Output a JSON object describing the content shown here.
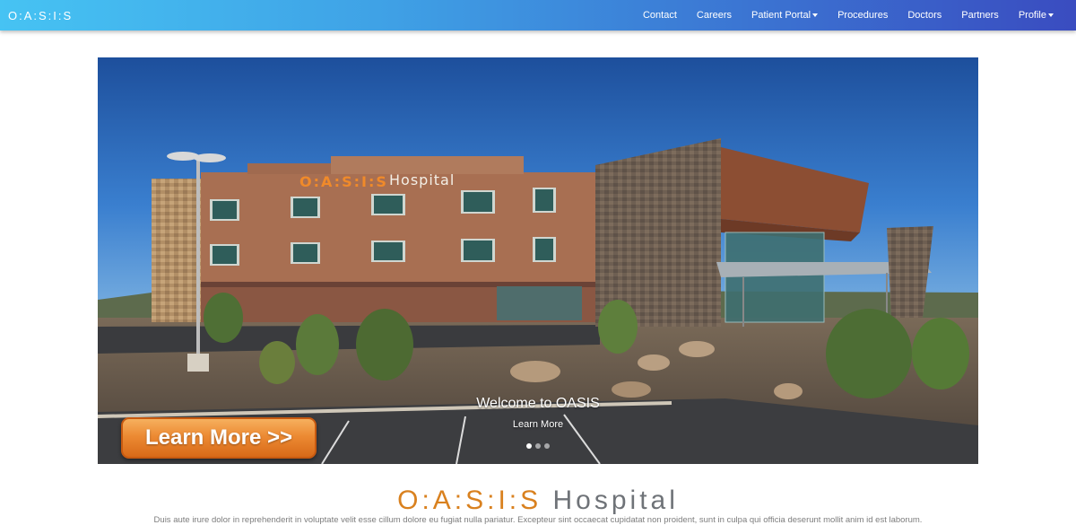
{
  "navbar": {
    "brand": "O:A:S:I:S",
    "links": [
      {
        "label": "Contact"
      },
      {
        "label": "Careers"
      },
      {
        "label": "Patient Portal"
      },
      {
        "label": "Procedures"
      },
      {
        "label": "Doctors"
      },
      {
        "label": "Partners"
      },
      {
        "label": "Profile"
      }
    ]
  },
  "carousel": {
    "building_sign": {
      "accent": "O:A:S:I:S",
      "rest": " Hospital"
    },
    "caption_title": "Welcome to OASIS",
    "caption_link": "Learn More",
    "slide_count": 3,
    "active_slide": 1,
    "learn_more_button": "Learn More >>"
  },
  "section": {
    "logo_accent": "O:A:S:I:S",
    "logo_rest": " Hospital",
    "lead_text": "Duis aute irure dolor in reprehenderit in voluptate velit esse cillum dolore eu fugiat nulla pariatur. Excepteur sint occaecat cupidatat non proident, sunt in culpa qui officia deserunt mollit anim id est laborum."
  },
  "colors": {
    "nav_gradient_start": "#46c3f3",
    "nav_gradient_end": "#3a4cc0",
    "logo_accent": "#d9811f",
    "logo_rest": "#6f7378",
    "button_orange": "#ec8a33"
  }
}
